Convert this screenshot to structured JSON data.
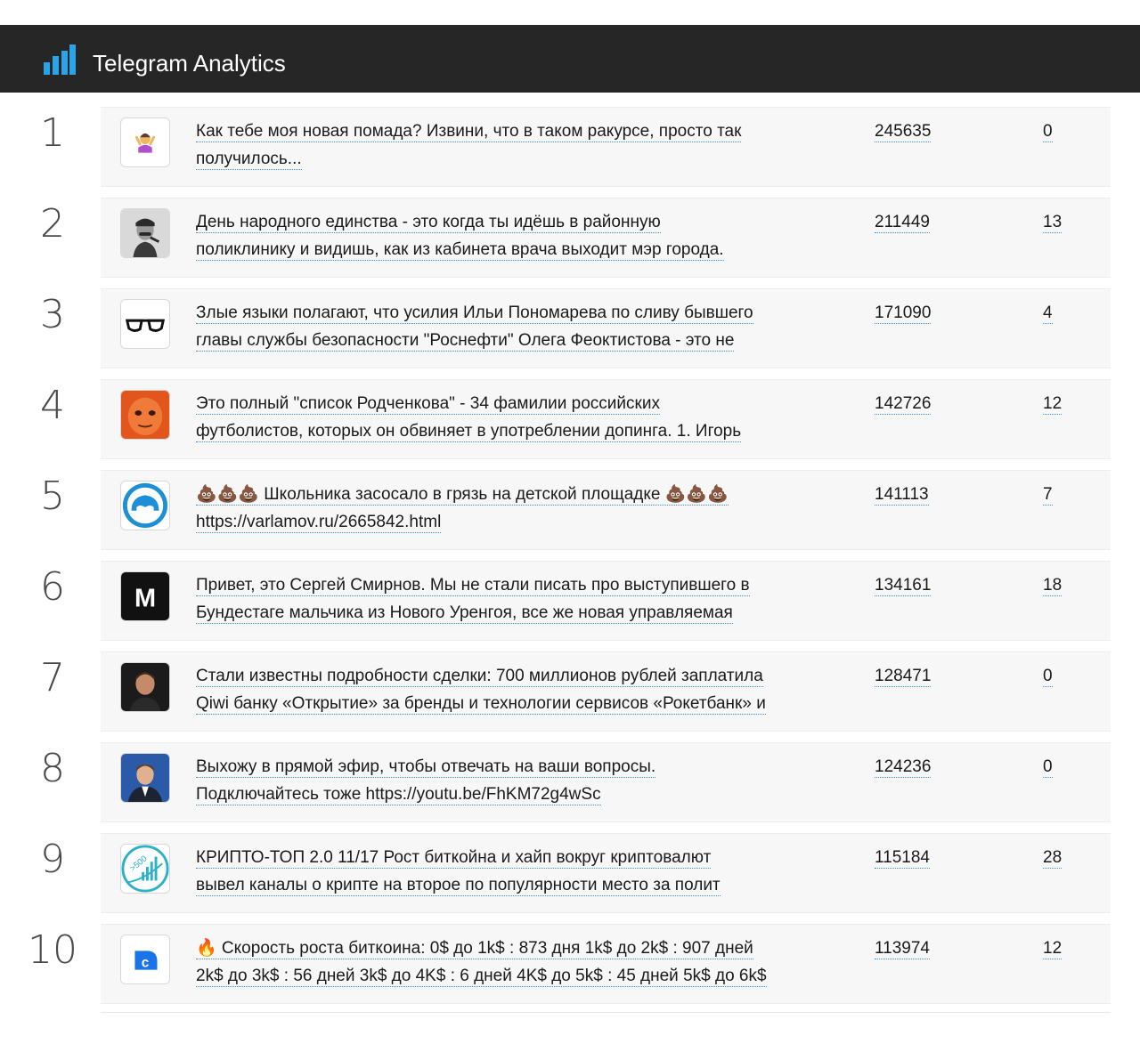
{
  "app": {
    "title": "Telegram Analytics",
    "accent": "#2aa3e8",
    "header_bg": "#262626"
  },
  "rows": [
    {
      "rank": "1",
      "avatar": "woman-shrug-emoji-icon",
      "text_line1": "Как тебе моя новая помада? Извини, что в таком ракурсе, просто так",
      "text_line2": "получилось...",
      "views": "245635",
      "comments": "0"
    },
    {
      "rank": "2",
      "avatar": "stalin-portrait-icon",
      "text_line1": "День народного единства - это когда ты идёшь в районную",
      "text_line2": "поликлинику и видишь, как из кабинета врача выходит мэр города.",
      "views": "211449",
      "comments": "13"
    },
    {
      "rank": "3",
      "avatar": "glasses-icon",
      "text_line1": "Злые языки полагают, что усилия Ильи Пономарева по сливу бывшего",
      "text_line2": "главы службы безопасности \"Роснефти\" Олега Феоктистова - это не",
      "views": "171090",
      "comments": "4"
    },
    {
      "rank": "4",
      "avatar": "orange-face-icon",
      "text_line1": "Это полный \"список Родченкова\" - 34 фамилии российских",
      "text_line2": "футболистов, которых он обвиняет в употреблении допинга. 1. Игорь",
      "views": "142726",
      "comments": "12"
    },
    {
      "rank": "5",
      "avatar": "blue-circle-logo-icon",
      "text_line1": "💩💩💩 Школьника засосало в грязь на детской площадке 💩💩💩",
      "text_line2": "https://varlamov.ru/2665842.html",
      "views": "141113",
      "comments": "7"
    },
    {
      "rank": "6",
      "avatar": "meduza-m-logo-icon",
      "avatar_letter": "M",
      "text_line1": "Привет, это Сергей Смирнов. Мы не стали писать про выступившего в",
      "text_line2": "Бундестаге мальчика из Нового Уренгоя, все же новая управляемая",
      "views": "134161",
      "comments": "18"
    },
    {
      "rank": "7",
      "avatar": "man-dark-portrait-icon",
      "text_line1": "Стали известны подробности сделки: 700 миллионов рублей заплатила",
      "text_line2": "Qiwi банку «Открытие» за бренды и технологии сервисов «Рокетбанк» и",
      "views": "128471",
      "comments": "0"
    },
    {
      "rank": "8",
      "avatar": "man-suit-portrait-icon",
      "text_line1": "Выхожу в прямой эфир, чтобы отвечать на ваши вопросы.",
      "text_line2": "Подключайтесь тоже https://youtu.be/FhKM72g4wSc",
      "views": "124236",
      "comments": "0"
    },
    {
      "rank": "9",
      "avatar": "crypto-500-chart-icon",
      "avatar_label": ">500",
      "text_line1": "КРИПТО-ТОП 2.0 11/17 Рост биткойна и хайп вокруг криптовалют",
      "text_line2": "вывел каналы о крипте на второе по популярности место за полит",
      "views": "115184",
      "comments": "28"
    },
    {
      "rank": "10",
      "avatar": "blue-c-logo-icon",
      "avatar_letter": "c",
      "text_line1": "🔥 Скорость роста биткоина: 0$ до 1k$ : 873 дня 1k$ до 2k$ : 907 дней",
      "text_line2": "2k$ до 3k$ : 56 дней 3k$ до 4K$ : 6 дней 4K$ до 5k$ : 45 дней 5k$ до 6k$",
      "views": "113974",
      "comments": "12"
    }
  ]
}
